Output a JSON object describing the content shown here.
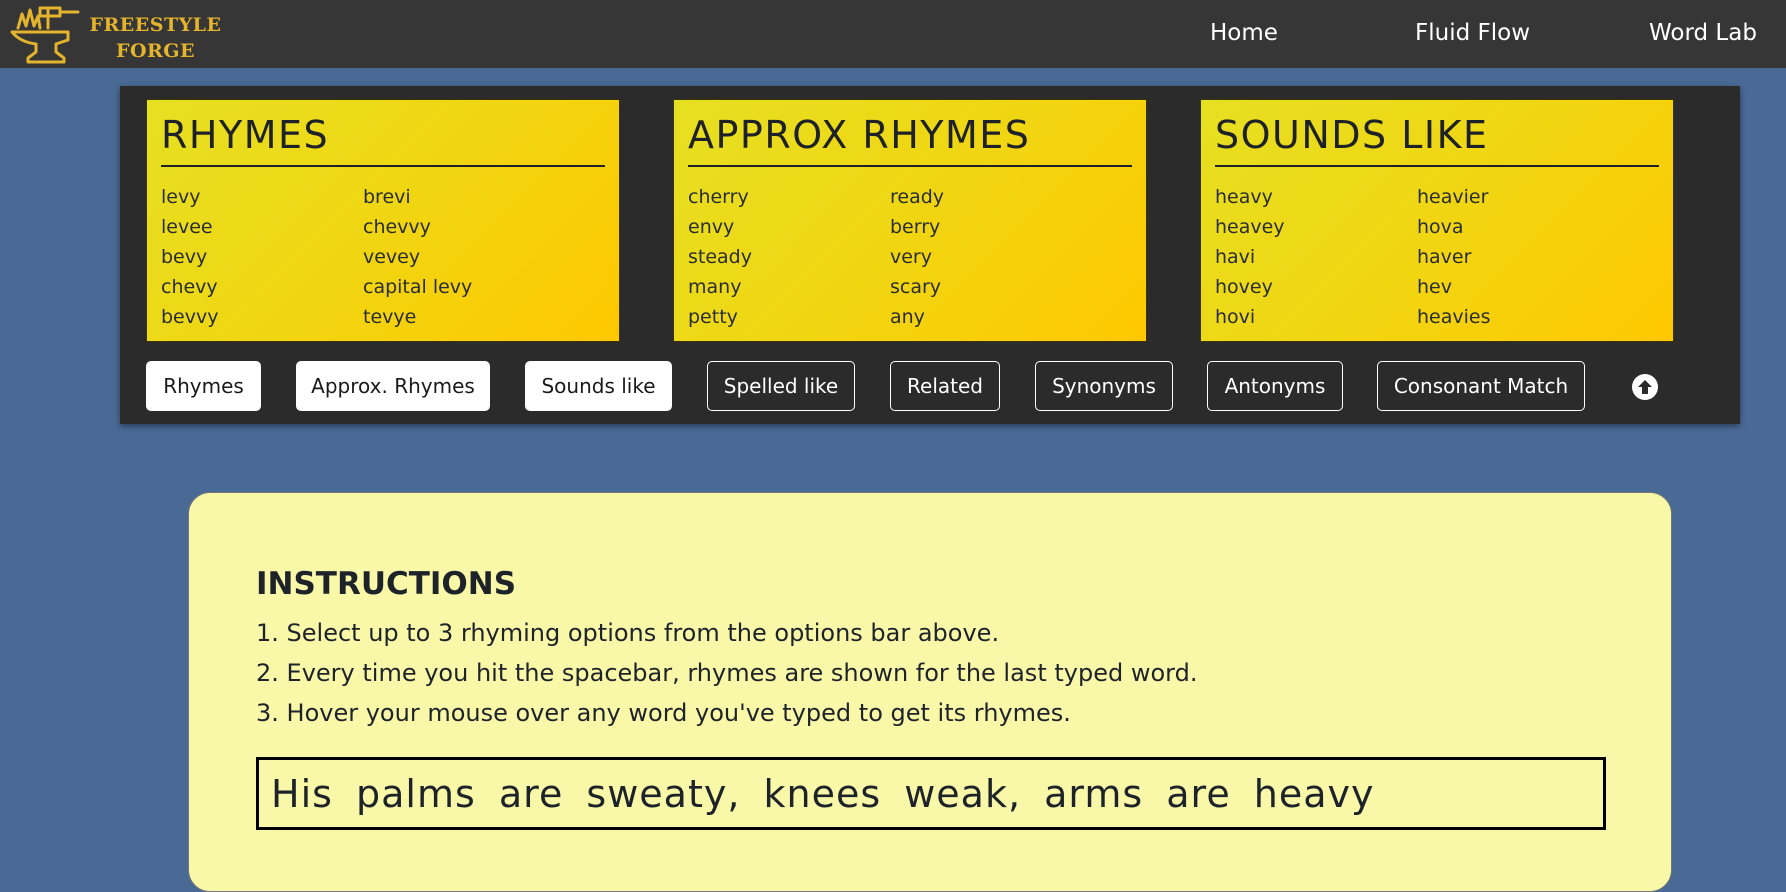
{
  "brand": {
    "line1": "FREESTYLE",
    "line2": "FORGE",
    "logo_icon": "anvil-hammer-icon",
    "color": "#e4b42c"
  },
  "nav": {
    "home": "Home",
    "fluid_flow": "Fluid Flow",
    "word_lab": "Word Lab"
  },
  "cards": {
    "rhymes": {
      "title": "RHYMES",
      "words": [
        "levy",
        "levee",
        "bevy",
        "chevy",
        "bevvy",
        "brevi",
        "chevvy",
        "vevey",
        "capital levy",
        "tevye"
      ]
    },
    "approx": {
      "title": "APPROX RHYMES",
      "words": [
        "cherry",
        "envy",
        "steady",
        "many",
        "petty",
        "ready",
        "berry",
        "very",
        "scary",
        "any"
      ]
    },
    "sounds": {
      "title": "SOUNDS LIKE",
      "words": [
        "heavy",
        "heavey",
        "havi",
        "hovey",
        "hovi",
        "heavier",
        "hova",
        "haver",
        "hev",
        "heavies"
      ]
    }
  },
  "options": {
    "rhymes": "Rhymes",
    "approx_rhymes": "Approx. Rhymes",
    "sounds_like": "Sounds like",
    "spelled_like": "Spelled like",
    "related": "Related",
    "synonyms": "Synonyms",
    "antonyms": "Antonyms",
    "consonant_match": "Consonant Match",
    "scroll_top_icon": "arrow-up-circle-icon"
  },
  "instructions": {
    "heading": "INSTRUCTIONS",
    "steps": [
      "1. Select up to 3 rhyming options from the options bar above.",
      "2. Every time you hit the spacebar, rhymes are shown for the last typed word.",
      "3. Hover your mouse over any word you've typed to get its rhymes."
    ]
  },
  "editor": {
    "text": "His palms are sweaty, knees weak, arms are heavy"
  },
  "colors": {
    "page_bg": "#4a6a96",
    "navbar_bg": "#363636",
    "panel_bg": "#2b2b2b",
    "card_yellow": "#f0d612",
    "instructions_bg": "#f8f8a8"
  }
}
